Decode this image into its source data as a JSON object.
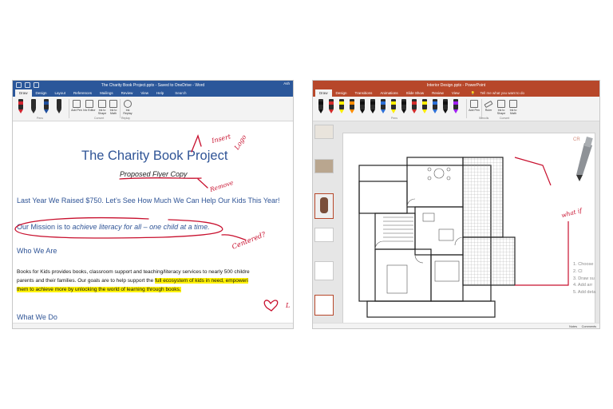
{
  "word": {
    "title": "The Charity Book Project.pptx - Saved to OneDrive - Word",
    "account": "Ash",
    "tabs": [
      "Draw",
      "Design",
      "Layout",
      "References",
      "Mailings",
      "Review",
      "View",
      "Help"
    ],
    "tell_me": "Search",
    "ribbon": {
      "buttons": [
        "Add Pen",
        "Ink Editor",
        "Ink to Shape",
        "Ink to Math",
        "Ink Replay"
      ],
      "groups": [
        "Pens",
        "Convert",
        "Replay"
      ]
    },
    "doc": {
      "title": "The Charity Book Project",
      "subtitle": "Proposed Flyer Copy",
      "h_raised": "Last Year We Raised $750. Let’s See How Much We Can Help Our Kids This Year!",
      "mission_prefix": "Our Mission is to ",
      "mission_italic": "achieve literacy for all – one child at a time.",
      "who": "Who We Are",
      "body_line1_a": "Books for Kids provides books, classroom support and teaching/literacy services to nearly 500 childre",
      "body_line2_a": "parents and their families. Our goals are to help support the ",
      "body_line2_hl": "full ecosystem of kids in need, empoweri",
      "body_line3_hl": "them to achieve more by unlocking the world of learning through books.",
      "what": "What We Do"
    },
    "ink": {
      "insert": "Insert",
      "logo": "Logo",
      "remove": "Remove",
      "centered": "Centered?",
      "l_char": "L"
    }
  },
  "ppt": {
    "title": "Interior Design.pptx - PowerPoint",
    "tabs": [
      "Draw",
      "Design",
      "Transitions",
      "Animations",
      "Slide Show",
      "Review",
      "View"
    ],
    "tell_me": "Tell me what you want to do",
    "ribbon": {
      "buttons": [
        "Add Pen",
        "Ruler",
        "Ink to Shape",
        "Ink to Math"
      ],
      "groups": [
        "Pens",
        "Stencils",
        "Convert"
      ]
    },
    "slide": {
      "ink_whatif": "what if",
      "corner_text": "CR",
      "list": [
        "1. Choose",
        "2. Cl",
        "3. Draw su",
        "4. Add arr",
        "5. Add deta"
      ]
    },
    "status": {
      "notes": "Notes",
      "comments": "Comments"
    }
  },
  "colors": {
    "word_accent": "#2b579a",
    "ppt_accent": "#b7472a",
    "ink_red": "#c8102e",
    "highlight": "#fff200",
    "heading_blue": "#2f5496"
  },
  "pen_colors_word": [
    "#d1242f",
    "#2b2b2b",
    "#1f4e9c",
    "#2b2b2b"
  ],
  "pen_colors_ppt": [
    "#111111",
    "#d12a2a",
    "#ffeb00",
    "#ff8c00",
    "#111111",
    "#111111",
    "#2c6fd6",
    "#ffeb00",
    "#111111",
    "#d12a2a",
    "#ffeb00",
    "#2c6fd6",
    "#111111",
    "#a020f0"
  ]
}
